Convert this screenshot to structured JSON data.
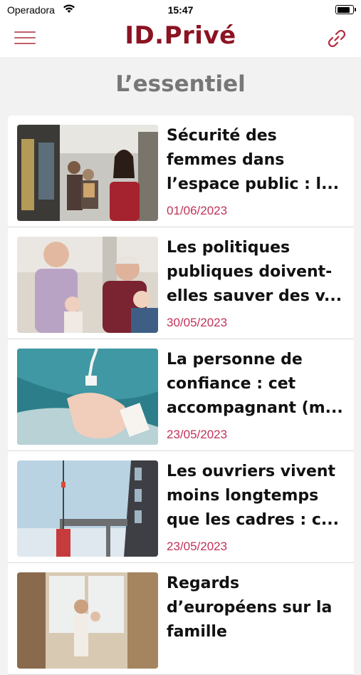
{
  "status": {
    "carrier": "Operadora",
    "time": "15:47",
    "battery_level": 0.85
  },
  "header": {
    "brand": "ID.Privé",
    "menu_icon": "hamburger-icon",
    "link_icon": "link-icon",
    "accent": "#8c1322"
  },
  "section": {
    "title": "L’essentiel"
  },
  "articles": [
    {
      "title": "Sécurité des\nfemmes dans\nl’espace public : l...",
      "date": "01/06/2023"
    },
    {
      "title": "Les politiques\npubliques doivent-\nelles sauver des v...",
      "date": "30/05/2023"
    },
    {
      "title": "La personne de\nconfiance : cet\naccompagnant (m...",
      "date": "23/05/2023"
    },
    {
      "title": "Les ouvriers vivent\nmoins longtemps\nque les cadres : c...",
      "date": "23/05/2023"
    },
    {
      "title": "Regards\nd’européens sur la\nfamille",
      "date": ""
    }
  ]
}
